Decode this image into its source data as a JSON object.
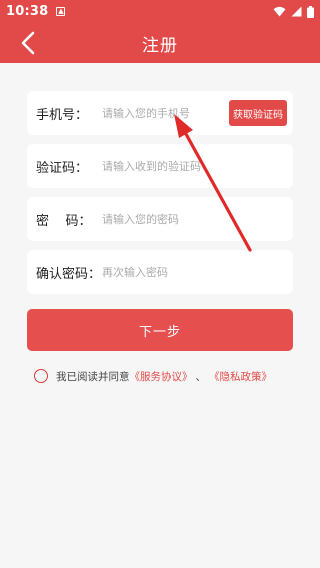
{
  "status_bar": {
    "time": "10:38",
    "notification_icon": "download-icon",
    "icons": [
      "wifi-icon",
      "signal-icon",
      "battery-icon"
    ]
  },
  "app_bar": {
    "title": "注册",
    "back_icon": "chevron-left-icon"
  },
  "form": {
    "phone": {
      "label": "手机号：",
      "placeholder": "请输入您的手机号",
      "value": ""
    },
    "sms_button": "获取验证码",
    "code": {
      "label": "验证码：",
      "placeholder": "请输入收到的验证码",
      "value": ""
    },
    "password": {
      "label": "密    码：",
      "placeholder": "请输入您的密码",
      "value": ""
    },
    "confirm": {
      "label": "确认密码：",
      "placeholder": "再次输入密码",
      "value": ""
    }
  },
  "next_button": "下一步",
  "agreement": {
    "text": "我已阅读并同意",
    "service_link": "《服务协议》",
    "separator": "、",
    "privacy_link": "《隐私政策》",
    "checked": false
  },
  "colors": {
    "accent": "#e24a49",
    "background": "#f6f6f6",
    "field_background": "#ffffff",
    "placeholder": "#aaaaaa"
  },
  "annotation": {
    "type": "arrow",
    "color": "#e02a2a",
    "points_to": "phone-input"
  }
}
